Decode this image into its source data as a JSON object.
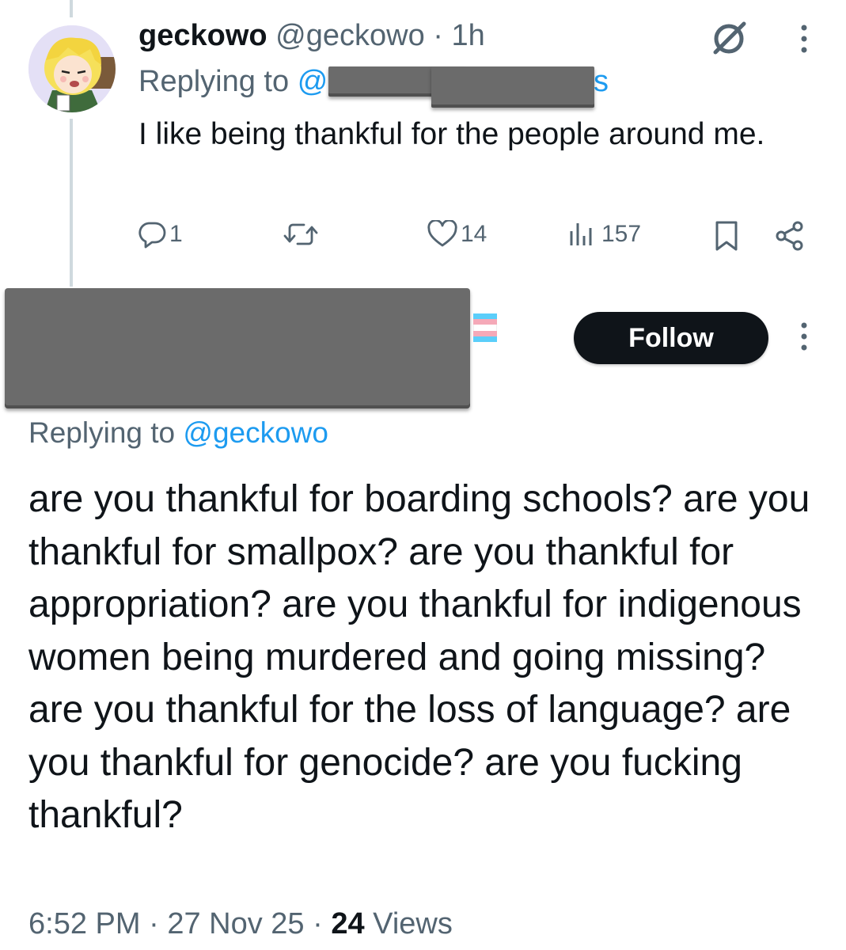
{
  "parent_tweet": {
    "display_name": "geckowo",
    "handle": "@geckowo",
    "separator": "·",
    "time": "1h",
    "replying_to_label": "Replying to",
    "replying_to_handle_visible_start": "@",
    "replying_to_handle_visible_end": "s",
    "text": "I like being thankful for the people around me.",
    "actions": {
      "reply_count": "1",
      "retweet_count": "",
      "like_count": "14",
      "views_count": "157"
    },
    "icons": [
      "grok-icon",
      "more-options-icon",
      "reply-icon",
      "retweet-icon",
      "like-icon",
      "views-icon",
      "bookmark-icon",
      "share-icon"
    ]
  },
  "reply_tweet": {
    "follow_label": "Follow",
    "replying_to_label": "Replying to",
    "replying_to_handle": "@geckowo",
    "text": "are you thankful for boarding schools? are you thankful for smallpox? are you thankful for appropriation? are you thankful for indigenous women being murdered and going missing? are you thankful for the loss of language? are you thankful for genocide? are you fucking thankful?",
    "time": "6:52 PM",
    "separator": "·",
    "date": "27 Nov 25",
    "views_count": "24",
    "views_label": "Views",
    "flag_colors": [
      "#5bcefa",
      "#f5a9b8",
      "#ffffff",
      "#f5a9b8",
      "#5bcefa"
    ]
  },
  "colors": {
    "text": "#0f1419",
    "muted": "#536471",
    "link": "#1d9bf0",
    "thread_line": "#cfd9de",
    "redaction": "#6b6b6b",
    "follow_bg": "#0f1419"
  }
}
